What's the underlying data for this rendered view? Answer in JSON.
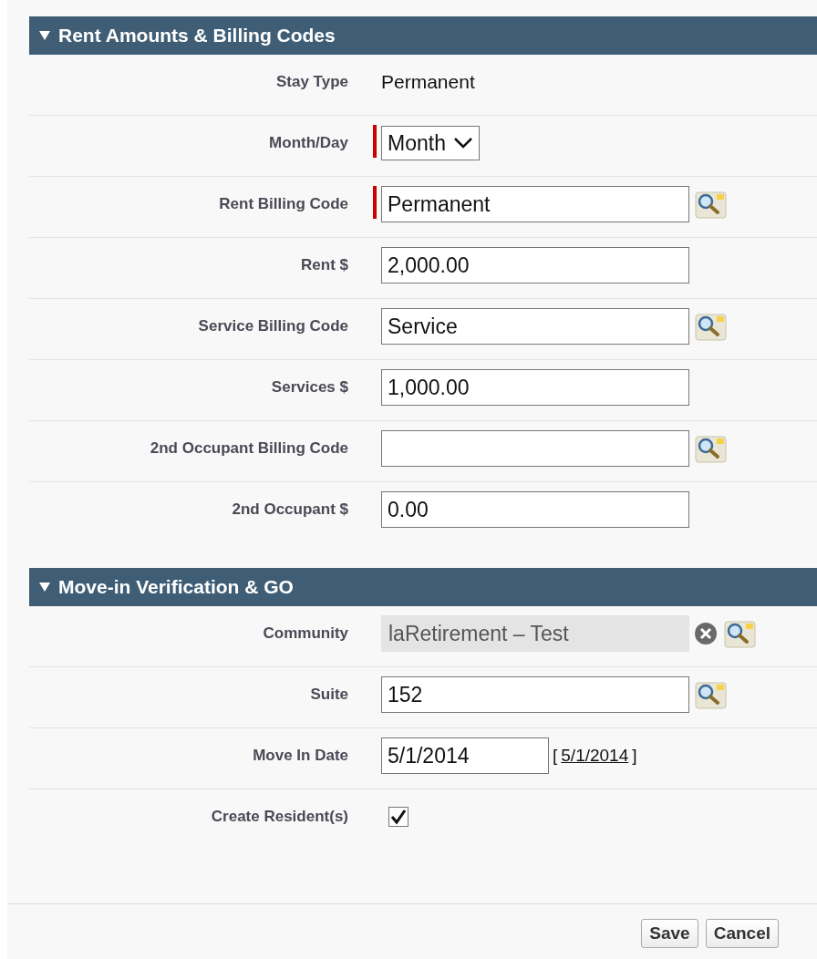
{
  "sections": [
    {
      "title": "Rent Amounts & Billing Codes",
      "expanded": true,
      "fields": [
        {
          "kind": "text",
          "label": "Stay Type",
          "value": "Permanent",
          "required": false
        },
        {
          "kind": "select",
          "label": "Month/Day",
          "value": "Month",
          "required": true
        },
        {
          "kind": "lookup",
          "label": "Rent Billing Code",
          "value": "Permanent",
          "required": true
        },
        {
          "kind": "input",
          "label": "Rent $",
          "value": "2,000.00",
          "required": false
        },
        {
          "kind": "lookup",
          "label": "Service Billing Code",
          "value": "Service",
          "required": false
        },
        {
          "kind": "input",
          "label": "Services $",
          "value": "1,000.00",
          "required": false
        },
        {
          "kind": "lookup",
          "label": "2nd Occupant Billing Code",
          "required": false
        },
        {
          "kind": "input",
          "label": "2nd Occupant $",
          "value": "0.00",
          "required": false
        }
      ]
    },
    {
      "title": "Move-in Verification & GO",
      "expanded": true,
      "fields": [
        {
          "kind": "locked-lookup",
          "label": "Community",
          "value": "laRetirement – Test",
          "required": false
        },
        {
          "kind": "lookup",
          "label": "Suite",
          "value": "152",
          "required": false
        },
        {
          "kind": "date",
          "label": "Move In Date",
          "value": "5/1/2014",
          "open_bracket": "[",
          "link": "5/1/2014",
          "close_bracket": "]",
          "required": false
        },
        {
          "kind": "checkbox",
          "label": "Create Resident(s)",
          "checked": true,
          "required": false
        }
      ]
    }
  ],
  "buttons": [
    "Save",
    "Cancel"
  ]
}
